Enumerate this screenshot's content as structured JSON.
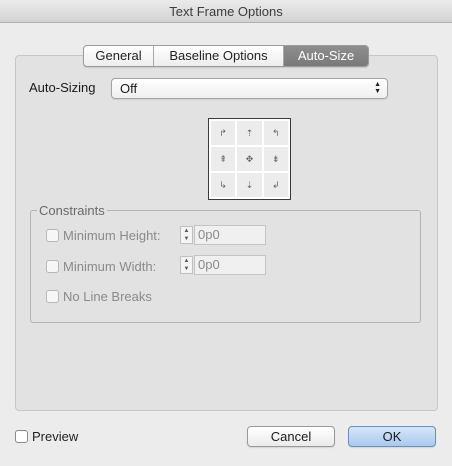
{
  "window": {
    "title": "Text Frame Options"
  },
  "tabs": [
    {
      "label": "General"
    },
    {
      "label": "Baseline Options"
    },
    {
      "label": "Auto-Size"
    }
  ],
  "autosizing": {
    "label": "Auto-Sizing",
    "selected": "Off"
  },
  "reference_point_grid": {
    "icons": [
      "↱",
      "⇡",
      "↰",
      "⇞",
      "✥",
      "⇟",
      "↳",
      "⇣",
      "↲"
    ]
  },
  "constraints": {
    "legend": "Constraints",
    "min_height": {
      "label": "Minimum Height:",
      "value": "0p0"
    },
    "min_width": {
      "label": "Minimum Width:",
      "value": "0p0"
    },
    "no_line_breaks": {
      "label": "No Line Breaks"
    }
  },
  "footer": {
    "preview_label": "Preview",
    "cancel_label": "Cancel",
    "ok_label": "OK"
  }
}
